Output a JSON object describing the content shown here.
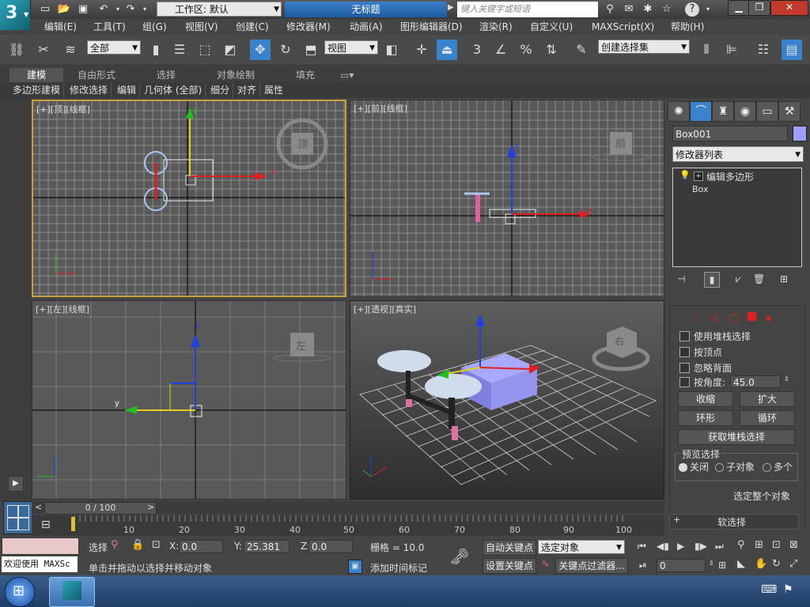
{
  "app": {
    "title": "无标题",
    "workspace_label": "工作区: 默认",
    "search_placeholder": "键入关键字或短语",
    "logo_text": "3"
  },
  "menus": [
    "编辑(E)",
    "工具(T)",
    "组(G)",
    "视图(V)",
    "创建(C)",
    "修改器(M)",
    "动画(A)",
    "图形编辑器(D)",
    "渲染(R)",
    "自定义(U)",
    "MAXScript(X)",
    "帮助(H)"
  ],
  "toolbar": {
    "selection_filter": "全部",
    "ref_coord": "视图",
    "named_selection": "创建选择集",
    "snap_number": "3",
    "percent_label": "%"
  },
  "ribbon": {
    "tabs": [
      "建模",
      "自由形式",
      "选择",
      "对象绘制",
      "填充"
    ],
    "buttons": [
      "多边形建模",
      "修改选择",
      "编辑",
      "几何体 (全部)",
      "细分",
      "对齐",
      "属性"
    ]
  },
  "viewports": [
    {
      "label": "[+][顶][线框]",
      "cube_text": "顶"
    },
    {
      "label": "[+][前][线框]",
      "cube_text": "前"
    },
    {
      "label": "[+][左][线框]",
      "cube_text": "左"
    },
    {
      "label": "[+][透视][真实]",
      "cube_text": "右"
    }
  ],
  "axis": {
    "x": "x",
    "y": "y",
    "z": "z"
  },
  "command_panel": {
    "object_name": "Box001",
    "modifier_list": "修改器列表",
    "stack_items": [
      "编辑多边形",
      "Box"
    ],
    "options": [
      "使用堆栈选择",
      "按顶点",
      "忽略背面",
      "按角度:"
    ],
    "angle_value": "45.0",
    "buttons": {
      "shrink": "收缩",
      "grow": "扩大",
      "ring": "环形",
      "loop": "循环",
      "get_stack": "获取堆栈选择"
    },
    "preview_title": "预览选择",
    "preview_options": [
      "关闭",
      "子对象",
      "多个"
    ],
    "select_whole": "选定整个对象",
    "soft_select": "软选择"
  },
  "timeline": {
    "frame_label": "0 / 100",
    "ticks": [
      "10",
      "20",
      "30",
      "40",
      "50",
      "60",
      "70",
      "80",
      "90",
      "100"
    ]
  },
  "status": {
    "maxscript_text": "欢迎使用 MAXSc",
    "selected_label": "选择",
    "x_label": "X:",
    "x_value": "0.0",
    "y_label": "Y:",
    "y_value": "25.381",
    "z_label": "Z:",
    "z_value": "0.0",
    "grid_label": "栅格 = 10.0",
    "prompt": "单击并拖动以选择并移动对象",
    "add_time_tag": "添加时间标记",
    "auto_key": "自动关键点",
    "set_key": "设置关键点",
    "key_mode": "选定对象",
    "key_filters": "关键点过滤器...",
    "frame_value": "0"
  },
  "colors": {
    "accent_blue": "#3a7fc8",
    "swatch": "#9f9fff",
    "key_red": "#e02020"
  }
}
